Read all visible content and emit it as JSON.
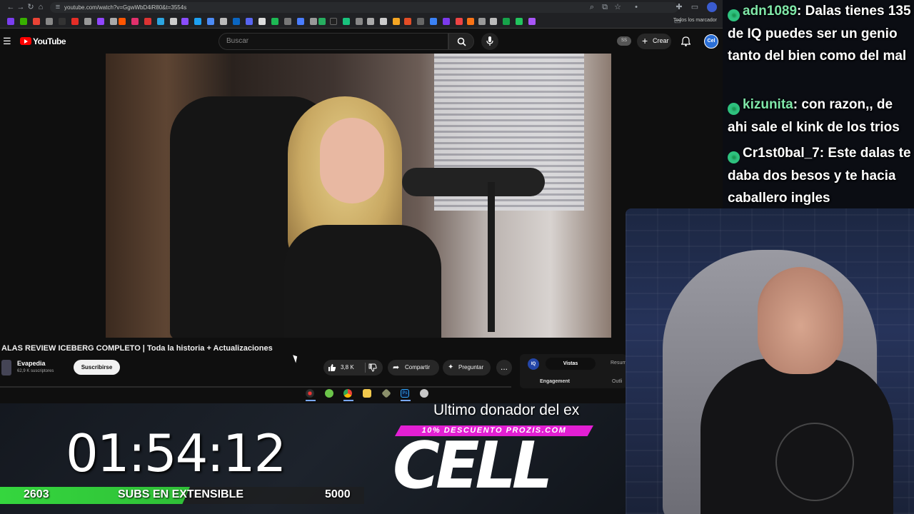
{
  "browser": {
    "url": "youtube.com/watch?v=GgwWbD4iR80&t=3554s",
    "bookmarks_all_label": "Todos los marcador"
  },
  "youtube": {
    "logo_text": "YouTube",
    "search_placeholder": "Buscar",
    "create_label": "Crear",
    "avatar_text": "Cel"
  },
  "video": {
    "title": "ALAS REVIEW ICEBERG COMPLETO | Toda la historia + Actualizaciones",
    "channel_name": "Evapedia",
    "channel_subs": "62,9 K suscriptores",
    "subscribe_label": "Suscribirse",
    "like_count": "3,8 K",
    "share_label": "Compartir",
    "ask_label": "Preguntar",
    "more_label": "..."
  },
  "extension": {
    "logo": "IQ",
    "tab_active": "Vistas",
    "tab_other": "Resum",
    "label_engagement": "Engagement",
    "label_outlier": "Outli"
  },
  "chat": {
    "messages": [
      {
        "user": "adn1089",
        "text": ": Dalas tienes 135 de IQ puedes ser un genio tanto del bien como del mal"
      },
      {
        "user": "kizunita",
        "text": ": con razon,, de ahi sale el kink de los trios"
      },
      {
        "user": "Cr1st0bal_7",
        "text": ": Este dalas te daba dos besos y te hacia caballero ingles"
      }
    ]
  },
  "overlay": {
    "timer": "01:54:12",
    "subs_current": "2603",
    "subs_label": "SUBS EN EXTENSIBLE",
    "subs_goal": "5000",
    "subs_progress_fraction": 0.5206,
    "donor_ticker": "Ultimo donador del ex",
    "promo_banner": "10% DESCUENTO PROZIS.COM",
    "sponsor_logo": "CELL"
  },
  "colors": {
    "accent_green": "#35d63e",
    "promo_pink": "#e21fd3",
    "youtube_red": "#ff0000"
  }
}
